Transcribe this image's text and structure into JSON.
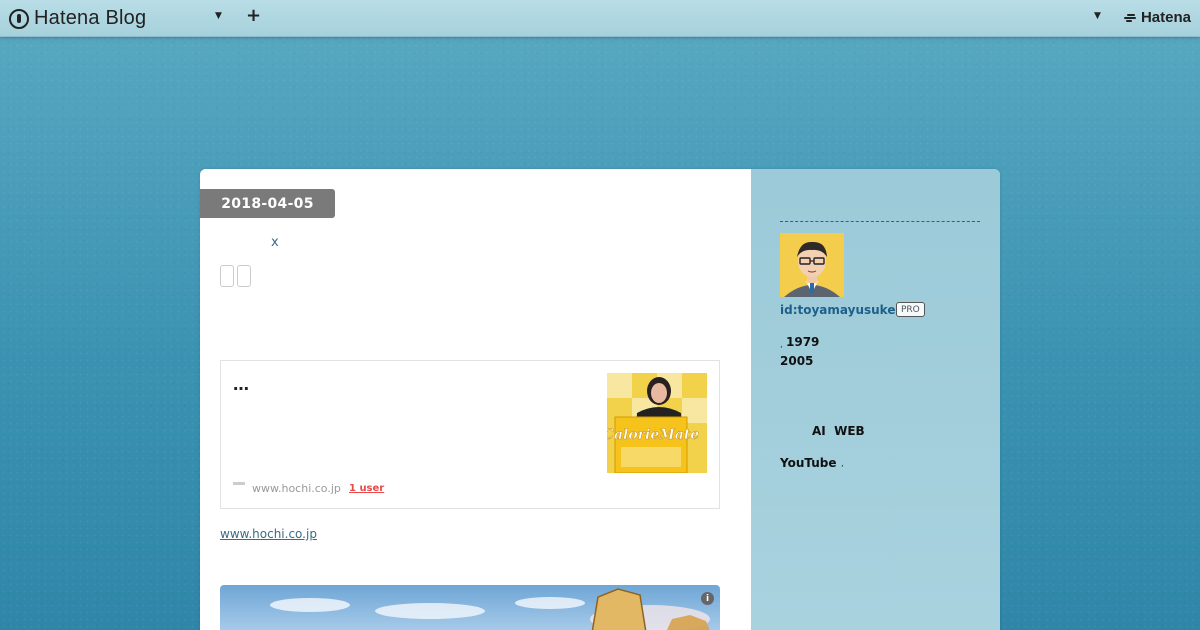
{
  "topbar": {
    "brand_text": "Hatena Blog",
    "hatena_text": "Hatena"
  },
  "entry": {
    "date": "2018-04-05",
    "title_fragment": "x",
    "embed": {
      "title": "…",
      "domain": "www.hochi.co.jp",
      "users": "1 user"
    },
    "source_link": "www.hochi.co.jp"
  },
  "sidebar": {
    "profile_id": "id:toyamayusuke",
    "pro_label": "PRO",
    "profile_year": "1979",
    "profile_year_comma": ",",
    "profile_since": "2005",
    "profile_interest": "AI  WEB",
    "profile_youtube": "YouTube",
    "profile_youtube_comma": ","
  },
  "colors": {
    "accent_link": "#1e5f8a",
    "date_badge": "#7a7a7a",
    "user_count": "#e64a4a"
  }
}
